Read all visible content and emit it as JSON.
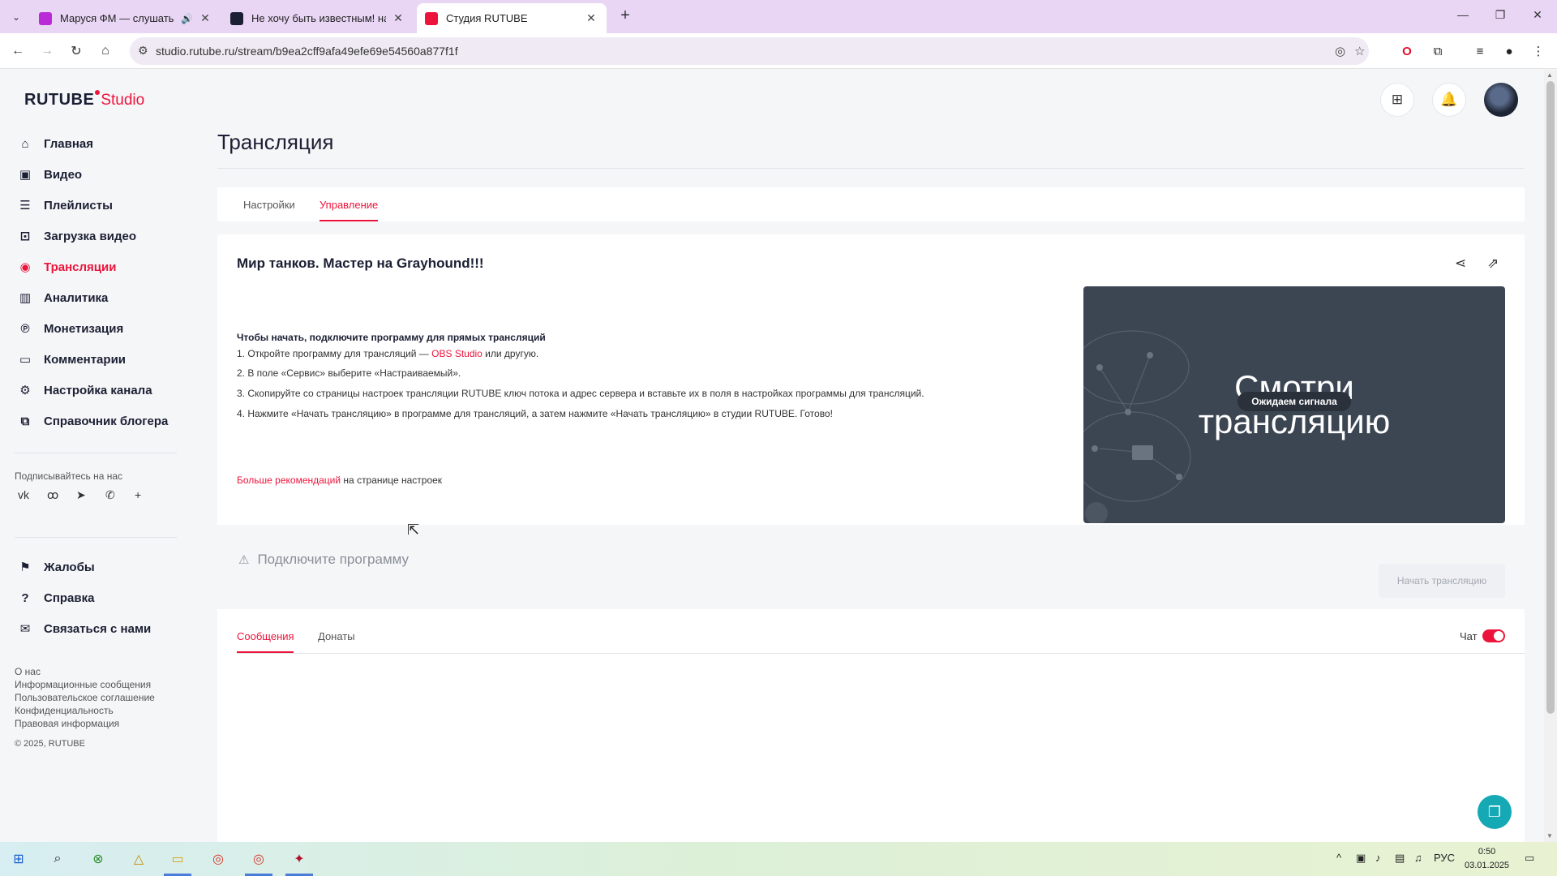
{
  "browser": {
    "tabs": [
      {
        "title": "Маруся ФМ — слушать онлайн",
        "fav_color": "#b92bd6",
        "audio": true
      },
      {
        "title": "Не хочу быть известным! на RUTUBE",
        "fav_color": "#1b1f33"
      },
      {
        "title": "Студия RUTUBE",
        "fav_color": "#ed143b"
      }
    ],
    "url": "studio.rutube.ru/stream/b9ea2cff9afa49efe69e54560a877f1f",
    "icons": {
      "tab_menu": "chevron-down-icon",
      "back": "back-arrow-icon",
      "forward": "forward-arrow-icon",
      "reload": "reload-icon",
      "home": "home-icon",
      "eye_off": "eye-off-icon",
      "star": "star-icon",
      "opera": "opera-icon",
      "extensions": "puzzle-icon",
      "media": "media-control-icon",
      "profile": "profile-icon",
      "menu": "kebab-menu-icon"
    }
  },
  "brand": {
    "accent": "#ed143b",
    "name_left": "RUTUBE",
    "name_right": "Studio"
  },
  "sidebar": {
    "items": [
      {
        "label": "Главная",
        "icon": "⌂"
      },
      {
        "label": "Видео",
        "icon": "▣"
      },
      {
        "label": "Плейлисты",
        "icon": "☰"
      },
      {
        "label": "Загрузка видео",
        "icon": "⊡"
      },
      {
        "label": "Трансляции",
        "icon": "((•))"
      },
      {
        "label": "Аналитика",
        "icon": "▥"
      },
      {
        "label": "Монетизация",
        "icon": "℗"
      },
      {
        "label": "Комментарии",
        "icon": "▭"
      },
      {
        "label": "Настройка канала",
        "icon": "⚙"
      },
      {
        "label": "Справочник блогера",
        "icon": "⧉"
      }
    ],
    "follow_label": "Подписывайтесь на нас",
    "socials": [
      "vk",
      "ok",
      "telegram",
      "viber",
      "more"
    ],
    "items2": [
      {
        "label": "Жалобы",
        "icon": "⚑"
      },
      {
        "label": "Справка",
        "icon": "?"
      },
      {
        "label": "Связаться с нами",
        "icon": "✉"
      }
    ],
    "footer_links": [
      "О нас",
      "Информационные сообщения",
      "Пользовательское соглашение",
      "Конфиденциальность",
      "Правовая информация"
    ],
    "copyright": "© 2025, RUTUBE"
  },
  "page": {
    "title": "Трансляция",
    "tabs": [
      "Настройки",
      "Управление"
    ],
    "stream": {
      "title": "Мир танков. Мастер на Grayhound!!!",
      "instructions_heading": "Чтобы начать, подключите программу для прямых трансляций",
      "step1_prefix": "1. Откройте программу для трансляций — ",
      "step1_link": "OBS Studio",
      "step1_suffix": " или другую.",
      "step2": "2. В поле «Сервис» выберите «Настраиваемый».",
      "step3": "3. Скопируйте со страницы настроек трансляции RUTUBE ключ потока и адрес сервера и вставьте их в поля в настройках программы для трансляций.",
      "step4": "4. Нажмите «Начать трансляцию» в программе для трансляций, а затем нажмите «Начать трансляцию» в студии RUTUBE. Готово!",
      "more_link": "Больше рекомендаций",
      "more_suffix": " на странице настроек",
      "preview_line1": "Смотри",
      "preview_line2": "трансляцию",
      "preview_badge": "Ожидаем сигнала",
      "connect_label": "Подключите программу",
      "start_button": "Начать трансляцию"
    },
    "chat": {
      "tabs": [
        "Сообщения",
        "Донаты"
      ],
      "chat_label": "Чат",
      "chat_enabled": true
    }
  },
  "taskbar": {
    "apps": [
      "windows-start-icon",
      "search-icon",
      "xbox-icon",
      "yandex-icon",
      "explorer-icon",
      "chrome-icon",
      "chrome-active-icon",
      "game-icon"
    ],
    "lang": "РУС",
    "time": "0:50",
    "date": "03.01.2025"
  }
}
